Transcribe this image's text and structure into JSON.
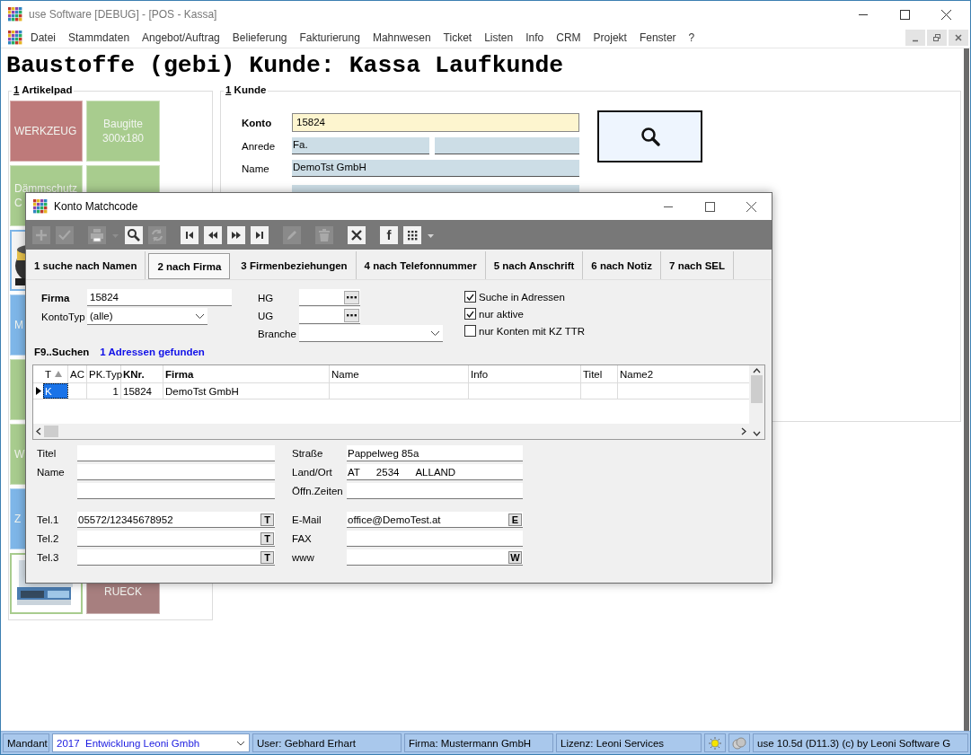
{
  "window": {
    "title": "use Software [DEBUG] - [POS - Kassa]"
  },
  "menu": [
    {
      "label": "Datei"
    },
    {
      "label": "Stammdaten"
    },
    {
      "label": "Angebot/Auftrag"
    },
    {
      "label": "Belieferung"
    },
    {
      "label": "Fakturierung"
    },
    {
      "label": "Mahnwesen"
    },
    {
      "label": "Ticket"
    },
    {
      "label": "Listen"
    },
    {
      "label": "Info"
    },
    {
      "label": "CRM"
    },
    {
      "label": "Projekt"
    },
    {
      "label": "Fenster"
    },
    {
      "label": "?"
    }
  ],
  "heading": "Baustoffe (gebi) Kunde: Kassa Laufkunde",
  "artikelpad": {
    "hotkey": "1",
    "title": "Artikelpad",
    "columns": [
      [
        {
          "kind": "text",
          "lines": [
            "WERKZEUG"
          ],
          "color": "#be7a7a"
        },
        {
          "kind": "text",
          "lines": [
            "Dämmschutz",
            "C"
          ],
          "color": "#a8cc8e"
        },
        {
          "kind": "picture",
          "color": "#7eb6e8"
        },
        {
          "kind": "text",
          "lines": [
            "M"
          ],
          "color": "#7eb6e8"
        },
        {
          "kind": "text",
          "color": "#a8cc8e"
        },
        {
          "kind": "text",
          "lines": [
            "W"
          ],
          "color": "#a8cc8e"
        },
        {
          "kind": "text",
          "lines": [
            "Z"
          ],
          "color": "#7eb6e8"
        },
        {
          "kind": "picture",
          "color": "#a8cc8e"
        }
      ],
      [
        {
          "kind": "text",
          "lines": [
            "Baugitte",
            "300x180"
          ],
          "color": "#a8cc8e"
        },
        {
          "kind": "text",
          "color": "#a8cc8e"
        },
        {
          "kind": "text",
          "lines": [
            "RUECK"
          ],
          "color": "#a77f7f"
        }
      ]
    ]
  },
  "kunde": {
    "hotkey": "1",
    "title": "Kunde",
    "fields": [
      {
        "kind": "account",
        "label": "Konto",
        "value": "15824"
      },
      {
        "kind": "split",
        "label": "Anrede",
        "value": "Fa."
      },
      {
        "kind": "plain",
        "label": "Name",
        "value": "DemoTst GmbH"
      },
      {
        "kind": "blank"
      }
    ]
  },
  "dialog": {
    "title": "Konto Matchcode",
    "toolbar": [
      {
        "kind": "add",
        "disabled": true
      },
      {
        "kind": "confirm",
        "disabled": true
      },
      {
        "kind": "print",
        "disabled": true
      },
      {
        "kind": "caret",
        "disabled": true
      },
      {
        "kind": "search",
        "disabled": false
      },
      {
        "kind": "refresh",
        "disabled": true
      },
      {
        "kind": "first",
        "disabled": false
      },
      {
        "kind": "prev",
        "disabled": false
      },
      {
        "kind": "next",
        "disabled": false
      },
      {
        "kind": "last",
        "disabled": false
      },
      {
        "kind": "edit",
        "disabled": true
      },
      {
        "kind": "delete",
        "disabled": true
      },
      {
        "kind": "close",
        "disabled": false
      },
      {
        "kind": "letter",
        "text": "f",
        "disabled": false
      },
      {
        "kind": "grid",
        "disabled": false
      },
      {
        "kind": "caret",
        "disabled": false
      }
    ],
    "tabs": [
      {
        "label": "1 suche nach Namen",
        "selected": false
      },
      {
        "label": "2 nach Firma",
        "selected": true
      },
      {
        "label": "3 Firmenbeziehungen",
        "selected": false
      },
      {
        "label": "4 nach Telefonnummer",
        "selected": false
      },
      {
        "label": "5 nach Anschrift",
        "selected": false
      },
      {
        "label": "6 nach Notiz",
        "selected": false
      },
      {
        "label": "7 nach SEL",
        "selected": false
      }
    ],
    "firma": {
      "label": "Firma",
      "value": "15824"
    },
    "kontotyp": {
      "label": "KontoTyp",
      "value": "(alle)"
    },
    "hg": {
      "label": "HG"
    },
    "ug": {
      "label": "UG"
    },
    "branche": {
      "label": "Branche"
    },
    "checks": [
      {
        "label": "Suche in Adressen",
        "checked": true
      },
      {
        "label": "nur aktive",
        "checked": true
      },
      {
        "label": "nur Konten mit KZ TTR",
        "checked": false
      }
    ],
    "search_hint": "F9..Suchen",
    "result": "1 Adressen gefunden",
    "table": {
      "columns": [
        {
          "label": "T",
          "sorted": true,
          "bold": false
        },
        {
          "label": "AC",
          "sorted": false,
          "bold": false
        },
        {
          "label": "PK.Typ",
          "sorted": false,
          "bold": false
        },
        {
          "label": "KNr.",
          "sorted": false,
          "bold": true
        },
        {
          "label": "Firma",
          "sorted": false,
          "bold": true
        },
        {
          "label": "Name",
          "sorted": false,
          "bold": false
        },
        {
          "label": "Info",
          "sorted": false,
          "bold": false
        },
        {
          "label": "Titel",
          "sorted": false,
          "bold": false
        },
        {
          "label": "Name2",
          "sorted": false,
          "bold": false
        }
      ],
      "rows": [
        {
          "selected": true,
          "cells": [
            "K",
            null,
            "1",
            "15824",
            "DemoTst GmbH",
            null,
            null,
            null,
            null
          ]
        }
      ]
    },
    "address_left": [
      {
        "kind": "text",
        "label": "Titel"
      },
      {
        "kind": "text",
        "label": "Name"
      },
      {
        "kind": "text"
      },
      {
        "kind": "phone",
        "label": "Tel.1",
        "value": "05572/12345678952",
        "action": "T"
      },
      {
        "kind": "phone",
        "label": "Tel.2",
        "action": "T"
      },
      {
        "kind": "phone",
        "label": "Tel.3",
        "action": "T"
      }
    ],
    "address_right": [
      {
        "kind": "text",
        "label": "Straße",
        "parts": [
          "Pappelweg 85a"
        ]
      },
      {
        "kind": "text",
        "label": "Land/Ort",
        "parts": [
          "AT",
          "2534",
          "ALLAND"
        ]
      },
      {
        "kind": "text",
        "label": "Öffn.Zeiten"
      },
      {
        "kind": "phone",
        "label": "E-Mail",
        "parts": [
          "office@DemoTest.at"
        ],
        "action": "E"
      },
      {
        "kind": "phone",
        "label": "FAX"
      },
      {
        "kind": "phone",
        "label": "www",
        "action": "W"
      }
    ]
  },
  "status_bar": {
    "label": "Mandant",
    "mandant": "2017  Entwicklung Leoni Gmbh",
    "user": "User: Gebhard Erhart",
    "firma": "Firma: Mustermann GmbH",
    "lizenz": "Lizenz: Leoni Services",
    "version": "use 10.5d (D11.3) (c) by Leoni Software G"
  }
}
